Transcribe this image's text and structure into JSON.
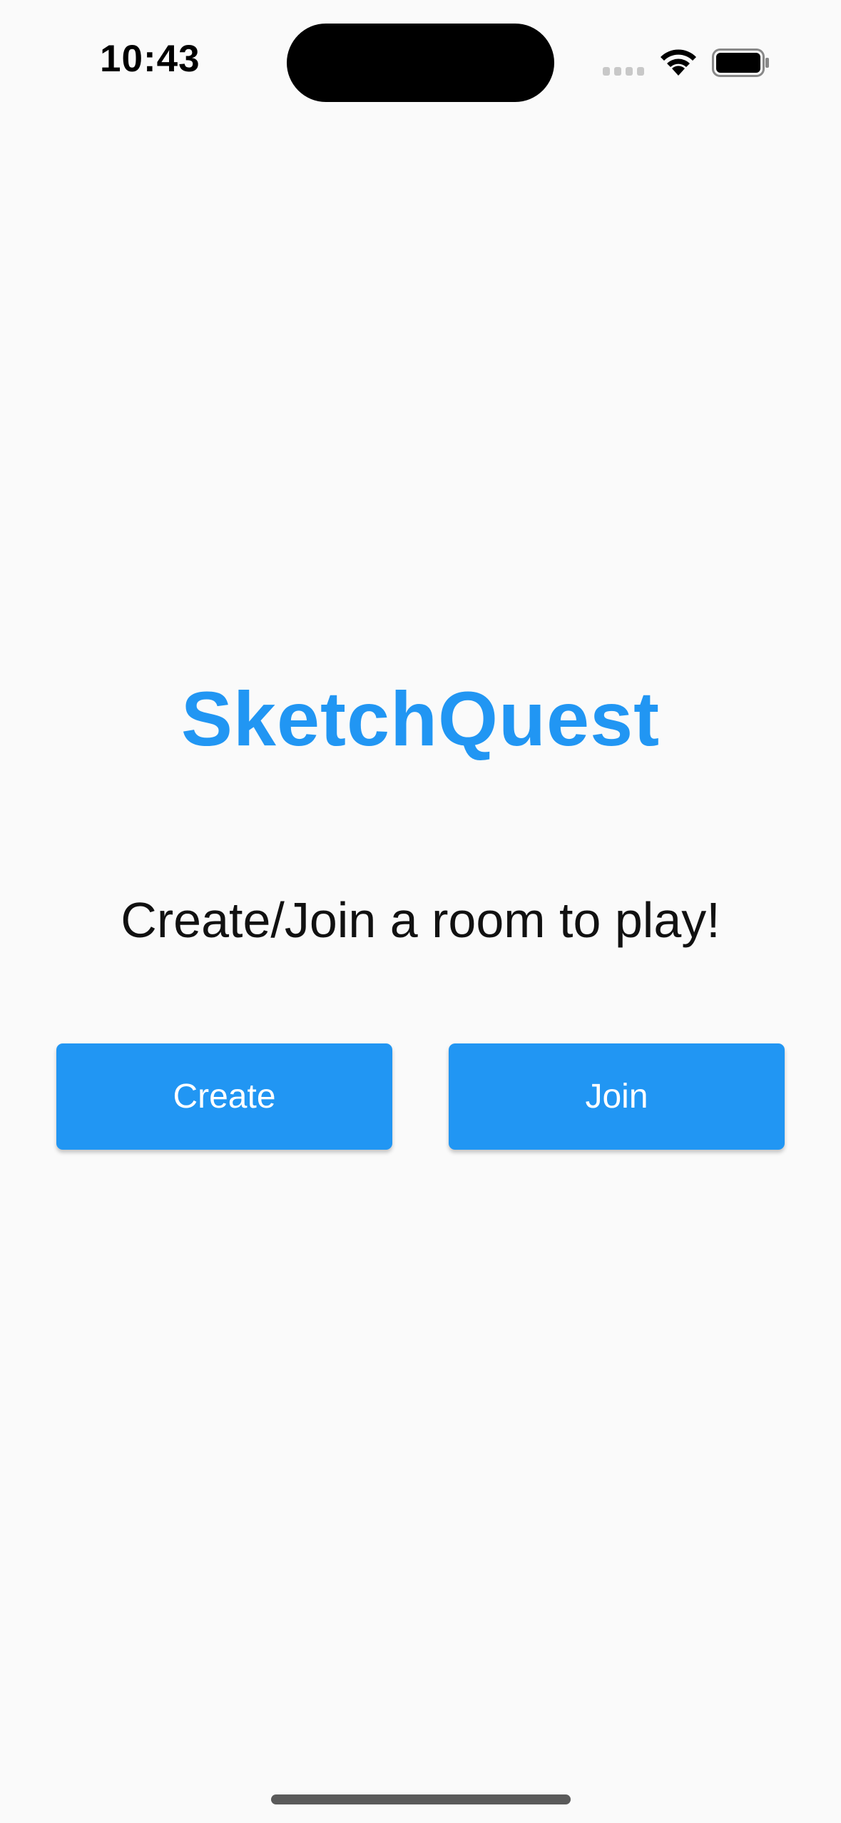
{
  "status_bar": {
    "time": "10:43",
    "icons": [
      "signal-icon",
      "wifi-icon",
      "battery-icon"
    ]
  },
  "app": {
    "title": "SketchQuest",
    "subtitle": "Create/Join a room to play!",
    "accent_color": "#2196f3"
  },
  "actions": {
    "create_label": "Create",
    "join_label": "Join"
  }
}
